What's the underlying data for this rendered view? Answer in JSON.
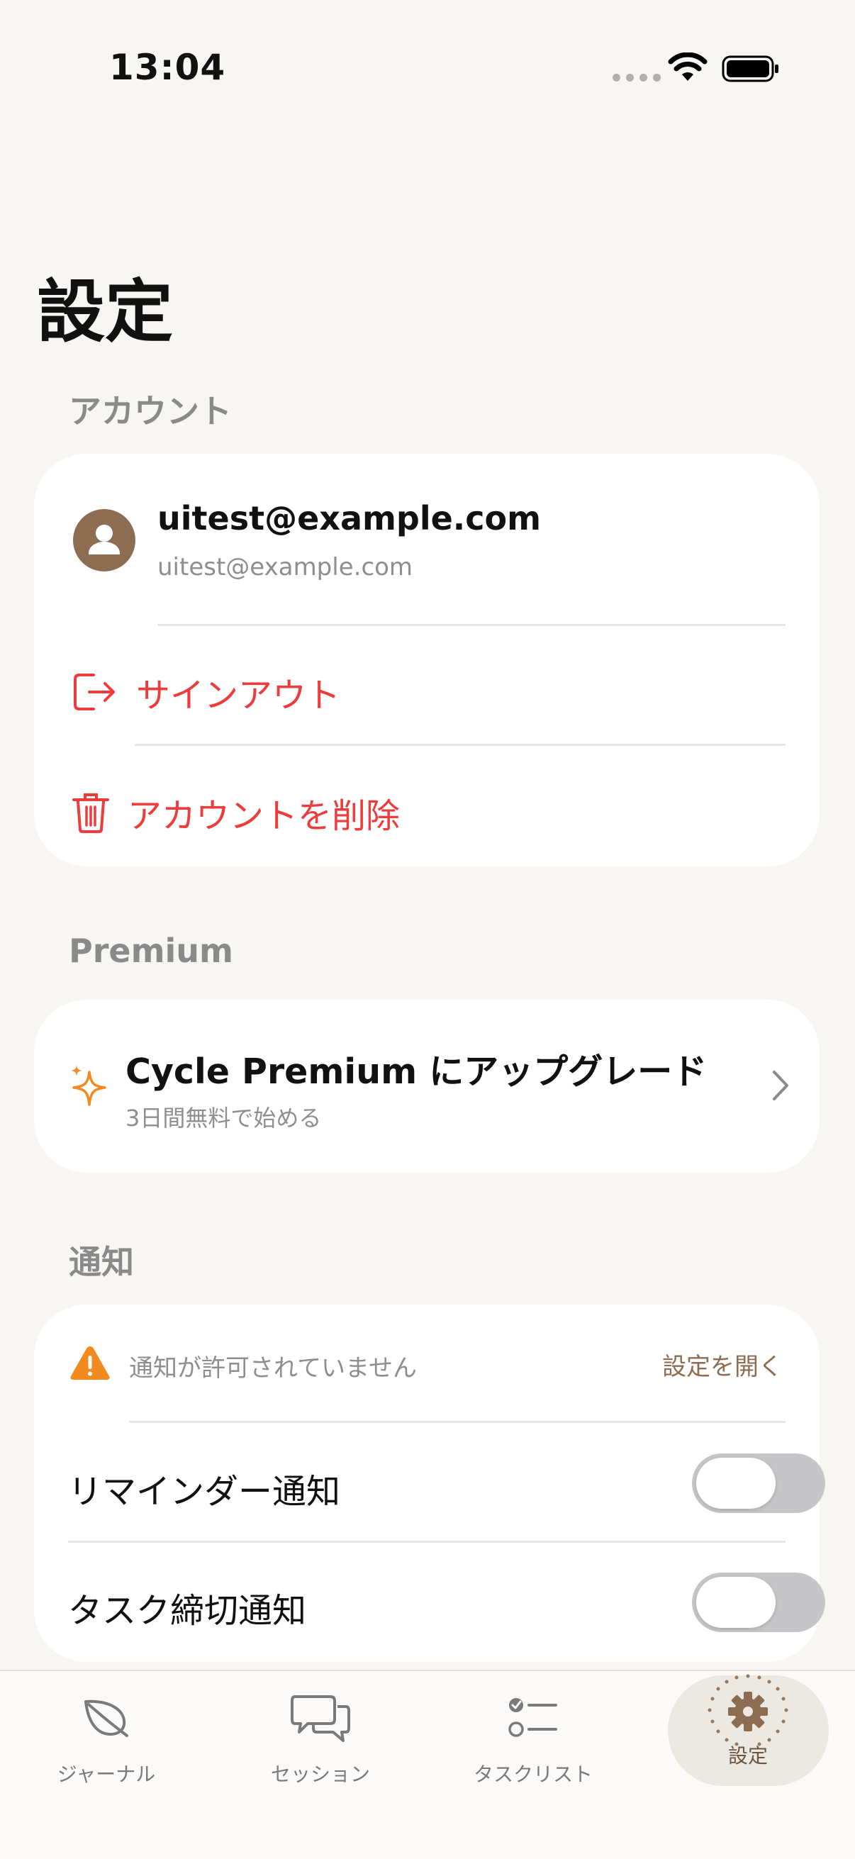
{
  "status": {
    "time": "13:04"
  },
  "page": {
    "title": "設定"
  },
  "account": {
    "section_label": "アカウント",
    "email": "uitest@example.com",
    "email_sub": "uitest@example.com",
    "sign_out": "サインアウト",
    "delete_account": "アカウントを削除"
  },
  "premium": {
    "section_label": "Premium",
    "title": "Cycle Premium にアップグレード",
    "subtitle": "3日間無料で始める"
  },
  "notifications": {
    "section_label": "通知",
    "warning": "通知が許可されていません",
    "open_settings": "設定を開く",
    "reminder_label": "リマインダー通知",
    "reminder_on": false,
    "task_deadline_label": "タスク締切通知",
    "task_deadline_on": false
  },
  "tabs": [
    {
      "label": "ジャーナル",
      "icon": "leaf-icon"
    },
    {
      "label": "セッション",
      "icon": "chat-bubbles-icon"
    },
    {
      "label": "タスクリスト",
      "icon": "checklist-icon"
    },
    {
      "label": "設定",
      "icon": "gear-icon",
      "active": true
    }
  ],
  "colors": {
    "danger": "#ee3b3b",
    "accent": "#8c6d52",
    "warning": "#f28a1f",
    "sparkle": "#f28a1f"
  }
}
